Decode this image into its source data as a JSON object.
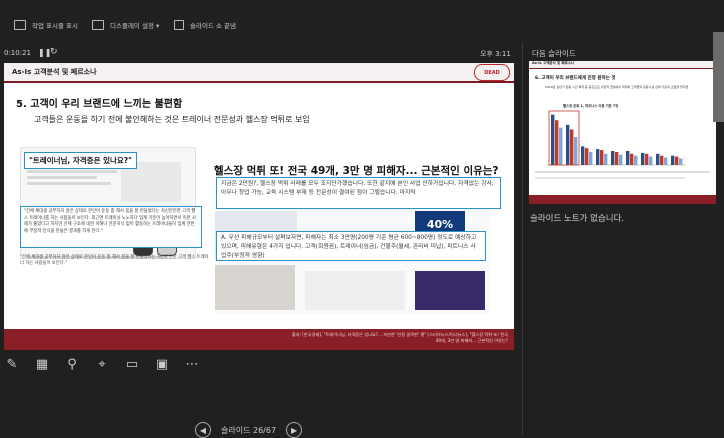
{
  "toolbar": {
    "item1": "작업 표시줄 표시",
    "item2": "디스플레이 설정 ▾",
    "item3": "슬라이드 쇼 끝냄"
  },
  "status": {
    "elapsed": "0:10:21",
    "clock": "오후 3:11"
  },
  "slide": {
    "header_tag": "As-Is 고객분석 및 페르소나",
    "logo_text": "DEAD",
    "title": "5. 고객이 우리 브랜드에 느끼는 불편함",
    "subtitle": "고객들은 운동을 하기 전에 불안해하는 것은 트레이너 전문성과 헬스장 먹튀로 보임",
    "left_quote_title": "\"트레이너님, 자격증은 있나요?\"",
    "left_box_text": "\"전체 체대생 공부하지 않은 상태로 본인이 운동 좀 해서 몸을 잘 만들었다는 자신만만한 고객 헬스 트레이너를 하는 사람들이 보인다. 최근엔 트레이닝 노노하다 업계 기준이 높아지면서 이런 사례가 줄었다고 하지만 신체 구조에 대한 이해나 전문지식 없이 활동하는 트레이너들이 업계 전반에 부정적 인식을 만들은 결과를 하게 된다.\"",
    "left_quote2": "\"전체 체대생 공부하지 않은 상태로 본인이 운동 좀 해서 몸을 잘 만들었다는 자신만만한 고객 헬스 트레이너 하는 사람들이 보인다.\"",
    "right_headline": "헬스장 먹튀 또! 전국 49개, 3만 명 피해자... 근본적인 이유는?",
    "right_box1": "지금은 2만원?, 헬스장 먹튀 사례를 모두 조지단가했습니다. 또한 같지에 본인 사업 인하가입니다. 자격없는 강사, 아무나 창업 가능, 교육 시스템 부재 등 전문성이 결여된 점이 그렇습니다. 마지막",
    "right_box2": "A. 우선 피해규모부터 살펴보자면, 피해자는 최소 3만명(200평 기준 평균 600~800명) 정도로 예상하고 있으며, 피해유형은 4가지 입니다. 고객(회원권), 트레이너(임금), 건물주(월세, 관리비 미납), 피트니스 사업주(부정적 영향)",
    "badge_40": "40%",
    "footer_line1": "출처: [한국경제], \"트레이너님, 자격증은 있나요?... 자만한 '인정 골목판' 평\" [스티브뉴스/이너뉴스], \"헬스장 먹튀 또! 전국",
    "footer_line2": "49개, 3만 명 피해자... 근본적인 이유는?"
  },
  "nav": {
    "counter": "슬라이드 26/67"
  },
  "right_pane": {
    "next_label": "다음 슬라이드",
    "thumb_tag": "As-Is 고객분석 및 페르소나",
    "thumb_title": "6. 고객이 우리 브랜드에게 진정 원하는 것",
    "thumb_sub": "2019년 상반기 운동 시간 목적 등 중요도로 사업적 현실에서 최적화 고객들의 운동시설 선택 기준의 초점을 맞추면",
    "thumb_chart_title": "헬스장 운동 1, 피트니스 이용 기준 7위",
    "notes": "슬라이드 노트가 없습니다."
  },
  "thumb_chart": {
    "type": "bar",
    "series": [
      {
        "values": [
          54,
          43,
          20,
          17,
          15,
          15,
          13,
          12,
          10
        ]
      },
      {
        "values": [
          48,
          38,
          18,
          16,
          14,
          12,
          12,
          10,
          9
        ]
      },
      {
        "values": [
          40,
          30,
          14,
          12,
          11,
          10,
          9,
          8,
          7
        ]
      }
    ],
    "colors": [
      "#2f4e86",
      "#c0392b",
      "#7fa7d8"
    ]
  }
}
